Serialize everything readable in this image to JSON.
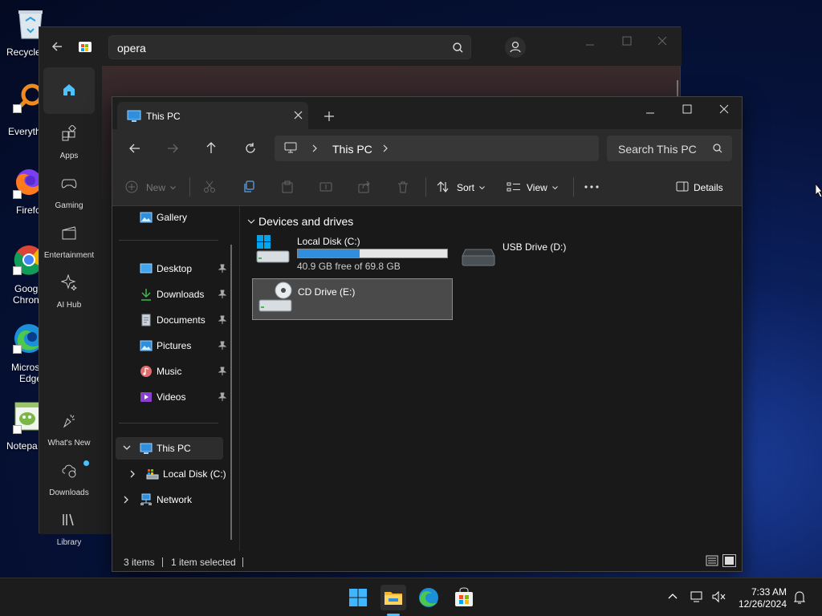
{
  "desktop": {
    "icons": [
      {
        "label": "Recycle"
      },
      {
        "label": "Everyth"
      },
      {
        "label": "Firefo"
      },
      {
        "label": "Goog"
      },
      {
        "label": "Chron"
      },
      {
        "label": "Micros"
      },
      {
        "label": "Edge"
      },
      {
        "label": "Notepa"
      }
    ]
  },
  "store": {
    "search_value": "opera",
    "sidebar": [
      {
        "label": ""
      },
      {
        "label": "Apps"
      },
      {
        "label": "Gaming"
      },
      {
        "label": "Entertainment"
      },
      {
        "label": "AI Hub"
      },
      {
        "label": "What's New"
      },
      {
        "label": "Downloads"
      },
      {
        "label": "Library"
      }
    ]
  },
  "explorer": {
    "tab_title": "This PC",
    "address": {
      "location": "This PC"
    },
    "search_placeholder": "Search This PC",
    "commands": {
      "new": "New",
      "sort": "Sort",
      "view": "View",
      "details": "Details"
    },
    "nav": {
      "gallery": "Gallery",
      "quick": [
        {
          "label": "Desktop"
        },
        {
          "label": "Downloads"
        },
        {
          "label": "Documents"
        },
        {
          "label": "Pictures"
        },
        {
          "label": "Music"
        },
        {
          "label": "Videos"
        }
      ],
      "this_pc": "This PC",
      "local_disk": "Local Disk (C:)",
      "network": "Network"
    },
    "section_title": "Devices and drives",
    "drives": [
      {
        "name": "Local Disk (C:)",
        "free_text": "40.9 GB free of 69.8 GB",
        "used_fraction": 0.414
      },
      {
        "name": "USB Drive (D:)"
      },
      {
        "name": "CD Drive (E:)"
      }
    ],
    "status": {
      "items": "3 items",
      "selected": "1 item selected"
    }
  },
  "taskbar": {
    "time": "7:33 AM",
    "date": "12/26/2024"
  },
  "colors": {
    "accent": "#2f8fde",
    "selected_bg": "#4a4a4a"
  }
}
